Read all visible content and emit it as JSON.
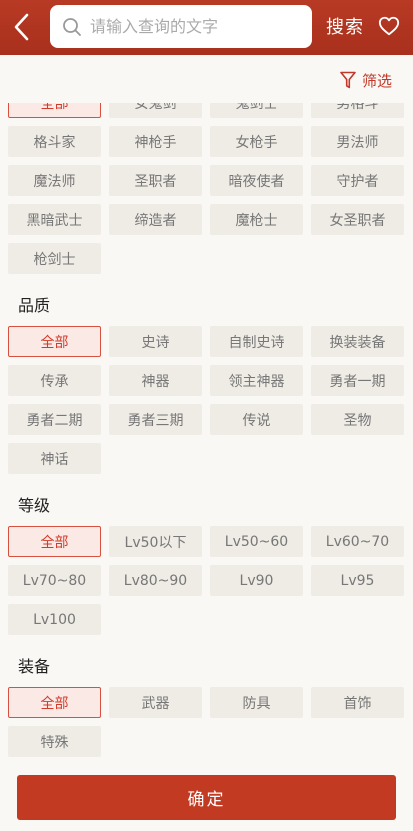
{
  "header": {
    "search_placeholder": "请输入查询的文字",
    "search_label": "搜索"
  },
  "filter": {
    "label": "筛选"
  },
  "sections": {
    "profession": {
      "items": [
        "全部",
        "女鬼剑",
        "鬼剑士",
        "男格斗",
        "格斗家",
        "神枪手",
        "女枪手",
        "男法师",
        "魔法师",
        "圣职者",
        "暗夜使者",
        "守护者",
        "黑暗武士",
        "缔造者",
        "魔枪士",
        "女圣职者",
        "枪剑士"
      ],
      "selected": 0
    },
    "quality": {
      "title": "品质",
      "items": [
        "全部",
        "史诗",
        "自制史诗",
        "换装装备",
        "传承",
        "神器",
        "领主神器",
        "勇者一期",
        "勇者二期",
        "勇者三期",
        "传说",
        "圣物",
        "神话"
      ],
      "selected": 0
    },
    "level": {
      "title": "等级",
      "items": [
        "全部",
        "Lv50以下",
        "Lv50~60",
        "Lv60~70",
        "Lv70~80",
        "Lv80~90",
        "Lv90",
        "Lv95",
        "Lv100"
      ],
      "selected": 0
    },
    "equipment": {
      "title": "装备",
      "items": [
        "全部",
        "武器",
        "防具",
        "首饰",
        "特殊"
      ],
      "selected": 0
    }
  },
  "footer": {
    "confirm_label": "确定"
  },
  "colors": {
    "header": "#b83a24",
    "accent": "#c23a22",
    "chip_bg": "#efebe5"
  },
  "icons": {
    "back": "chevron-left-icon",
    "search": "search-icon",
    "favorite": "heart-icon",
    "filter": "filter-funnel-icon"
  }
}
